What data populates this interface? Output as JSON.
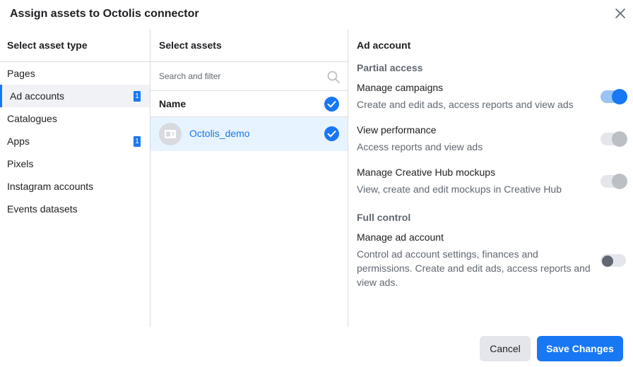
{
  "dialog": {
    "title": "Assign assets to Octolis connector"
  },
  "asset_types": {
    "header": "Select asset type",
    "items": [
      {
        "label": "Pages",
        "badge": ""
      },
      {
        "label": "Ad accounts",
        "badge": "1"
      },
      {
        "label": "Catalogues",
        "badge": ""
      },
      {
        "label": "Apps",
        "badge": "1"
      },
      {
        "label": "Pixels",
        "badge": ""
      },
      {
        "label": "Instagram accounts",
        "badge": ""
      },
      {
        "label": "Events datasets",
        "badge": ""
      }
    ],
    "active_index": 1
  },
  "assets": {
    "header": "Select assets",
    "search_placeholder": "Search and filter",
    "name_column": "Name",
    "rows": [
      {
        "name": "Octolis_demo",
        "selected": true
      }
    ]
  },
  "permissions": {
    "header": "Ad account",
    "partial_label": "Partial access",
    "full_label": "Full control",
    "items": [
      {
        "title": "Manage campaigns",
        "description": "Create and edit ads, access reports and view ads",
        "state": "on"
      },
      {
        "title": "View performance",
        "description": "Access reports and view ads",
        "state": "disabled"
      },
      {
        "title": "Manage Creative Hub mockups",
        "description": "View, create and edit mockups in Creative Hub",
        "state": "disabled"
      },
      {
        "title": "Manage ad account",
        "description": "Control ad account settings, finances and permissions. Create and edit ads, access reports and view ads.",
        "state": "off"
      }
    ]
  },
  "footer": {
    "cancel_label": "Cancel",
    "save_label": "Save Changes"
  },
  "colors": {
    "accent": "#1877f2",
    "selected_row": "#e7f3ff",
    "muted_text": "#606770"
  }
}
